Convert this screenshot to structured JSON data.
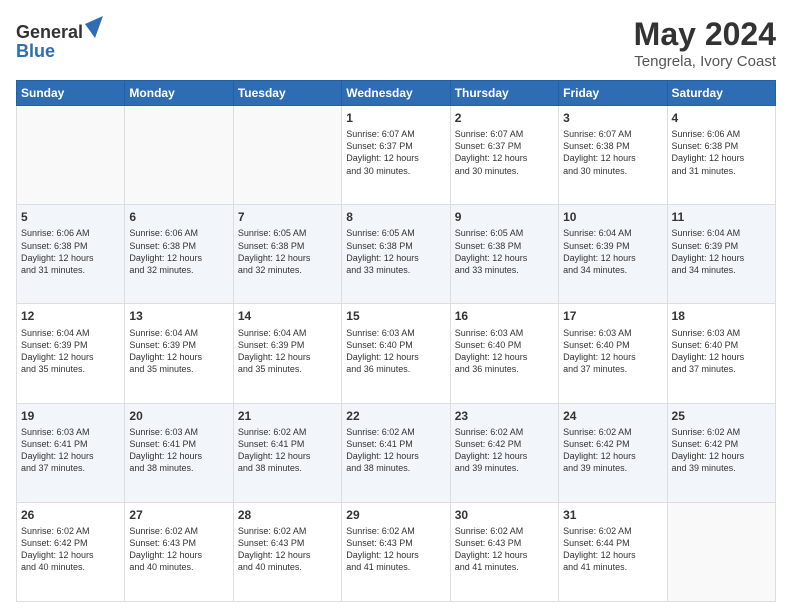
{
  "header": {
    "logo_line1": "General",
    "logo_line2": "Blue",
    "month_year": "May 2024",
    "location": "Tengrela, Ivory Coast"
  },
  "weekdays": [
    "Sunday",
    "Monday",
    "Tuesday",
    "Wednesday",
    "Thursday",
    "Friday",
    "Saturday"
  ],
  "weeks": [
    [
      {
        "day": "",
        "info": ""
      },
      {
        "day": "",
        "info": ""
      },
      {
        "day": "",
        "info": ""
      },
      {
        "day": "1",
        "info": "Sunrise: 6:07 AM\nSunset: 6:37 PM\nDaylight: 12 hours\nand 30 minutes."
      },
      {
        "day": "2",
        "info": "Sunrise: 6:07 AM\nSunset: 6:37 PM\nDaylight: 12 hours\nand 30 minutes."
      },
      {
        "day": "3",
        "info": "Sunrise: 6:07 AM\nSunset: 6:38 PM\nDaylight: 12 hours\nand 30 minutes."
      },
      {
        "day": "4",
        "info": "Sunrise: 6:06 AM\nSunset: 6:38 PM\nDaylight: 12 hours\nand 31 minutes."
      }
    ],
    [
      {
        "day": "5",
        "info": "Sunrise: 6:06 AM\nSunset: 6:38 PM\nDaylight: 12 hours\nand 31 minutes."
      },
      {
        "day": "6",
        "info": "Sunrise: 6:06 AM\nSunset: 6:38 PM\nDaylight: 12 hours\nand 32 minutes."
      },
      {
        "day": "7",
        "info": "Sunrise: 6:05 AM\nSunset: 6:38 PM\nDaylight: 12 hours\nand 32 minutes."
      },
      {
        "day": "8",
        "info": "Sunrise: 6:05 AM\nSunset: 6:38 PM\nDaylight: 12 hours\nand 33 minutes."
      },
      {
        "day": "9",
        "info": "Sunrise: 6:05 AM\nSunset: 6:38 PM\nDaylight: 12 hours\nand 33 minutes."
      },
      {
        "day": "10",
        "info": "Sunrise: 6:04 AM\nSunset: 6:39 PM\nDaylight: 12 hours\nand 34 minutes."
      },
      {
        "day": "11",
        "info": "Sunrise: 6:04 AM\nSunset: 6:39 PM\nDaylight: 12 hours\nand 34 minutes."
      }
    ],
    [
      {
        "day": "12",
        "info": "Sunrise: 6:04 AM\nSunset: 6:39 PM\nDaylight: 12 hours\nand 35 minutes."
      },
      {
        "day": "13",
        "info": "Sunrise: 6:04 AM\nSunset: 6:39 PM\nDaylight: 12 hours\nand 35 minutes."
      },
      {
        "day": "14",
        "info": "Sunrise: 6:04 AM\nSunset: 6:39 PM\nDaylight: 12 hours\nand 35 minutes."
      },
      {
        "day": "15",
        "info": "Sunrise: 6:03 AM\nSunset: 6:40 PM\nDaylight: 12 hours\nand 36 minutes."
      },
      {
        "day": "16",
        "info": "Sunrise: 6:03 AM\nSunset: 6:40 PM\nDaylight: 12 hours\nand 36 minutes."
      },
      {
        "day": "17",
        "info": "Sunrise: 6:03 AM\nSunset: 6:40 PM\nDaylight: 12 hours\nand 37 minutes."
      },
      {
        "day": "18",
        "info": "Sunrise: 6:03 AM\nSunset: 6:40 PM\nDaylight: 12 hours\nand 37 minutes."
      }
    ],
    [
      {
        "day": "19",
        "info": "Sunrise: 6:03 AM\nSunset: 6:41 PM\nDaylight: 12 hours\nand 37 minutes."
      },
      {
        "day": "20",
        "info": "Sunrise: 6:03 AM\nSunset: 6:41 PM\nDaylight: 12 hours\nand 38 minutes."
      },
      {
        "day": "21",
        "info": "Sunrise: 6:02 AM\nSunset: 6:41 PM\nDaylight: 12 hours\nand 38 minutes."
      },
      {
        "day": "22",
        "info": "Sunrise: 6:02 AM\nSunset: 6:41 PM\nDaylight: 12 hours\nand 38 minutes."
      },
      {
        "day": "23",
        "info": "Sunrise: 6:02 AM\nSunset: 6:42 PM\nDaylight: 12 hours\nand 39 minutes."
      },
      {
        "day": "24",
        "info": "Sunrise: 6:02 AM\nSunset: 6:42 PM\nDaylight: 12 hours\nand 39 minutes."
      },
      {
        "day": "25",
        "info": "Sunrise: 6:02 AM\nSunset: 6:42 PM\nDaylight: 12 hours\nand 39 minutes."
      }
    ],
    [
      {
        "day": "26",
        "info": "Sunrise: 6:02 AM\nSunset: 6:42 PM\nDaylight: 12 hours\nand 40 minutes."
      },
      {
        "day": "27",
        "info": "Sunrise: 6:02 AM\nSunset: 6:43 PM\nDaylight: 12 hours\nand 40 minutes."
      },
      {
        "day": "28",
        "info": "Sunrise: 6:02 AM\nSunset: 6:43 PM\nDaylight: 12 hours\nand 40 minutes."
      },
      {
        "day": "29",
        "info": "Sunrise: 6:02 AM\nSunset: 6:43 PM\nDaylight: 12 hours\nand 41 minutes."
      },
      {
        "day": "30",
        "info": "Sunrise: 6:02 AM\nSunset: 6:43 PM\nDaylight: 12 hours\nand 41 minutes."
      },
      {
        "day": "31",
        "info": "Sunrise: 6:02 AM\nSunset: 6:44 PM\nDaylight: 12 hours\nand 41 minutes."
      },
      {
        "day": "",
        "info": ""
      }
    ]
  ]
}
